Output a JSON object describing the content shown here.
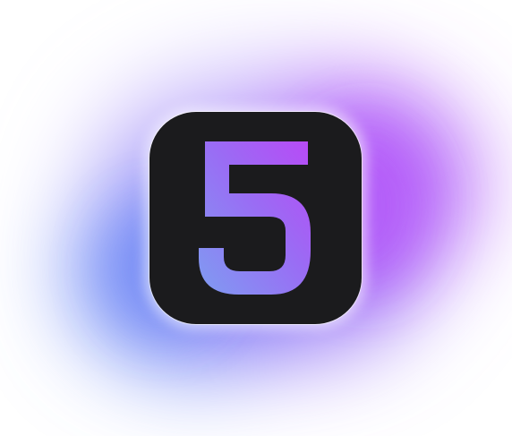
{
  "app_icon": {
    "numeral": "5",
    "icon_name": "five-numeral-icon",
    "tile_color": "#1b1b1d",
    "gradient_colors": [
      "#7f9cf2",
      "#a05cf3",
      "#b44cf5"
    ],
    "glow_colors": [
      "#7a86f6",
      "#a64cf8"
    ]
  }
}
